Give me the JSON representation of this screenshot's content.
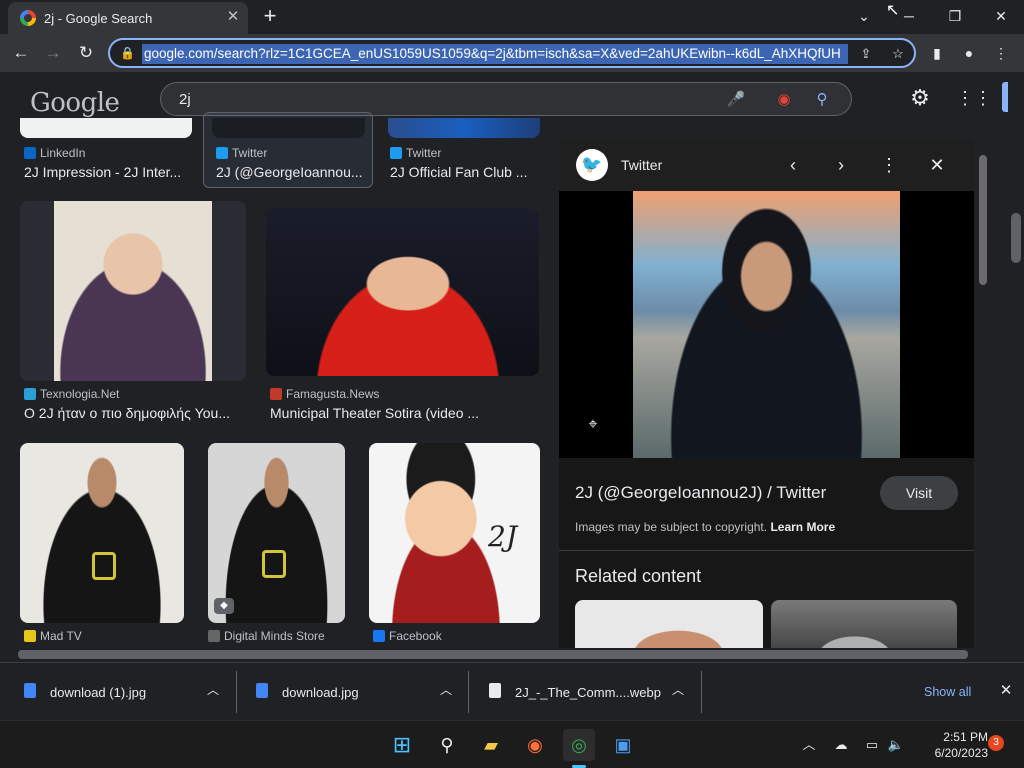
{
  "browser": {
    "tab_title": "2j - Google Search",
    "tab_close": "✕",
    "new_tab": "+",
    "url": "google.com/search?rlz=1C1GCEA_enUS1059US1059&q=2j&tbm=isch&sa=X&ved=2ahUKEwibn--k6dL_AhXHQfUH"
  },
  "google": {
    "logo": "Google",
    "query": "2j"
  },
  "results": {
    "row0": [
      {
        "source": "LinkedIn",
        "caption": "2J Impression - 2J Inter..."
      },
      {
        "source": "Twitter",
        "caption": "2J (@GeorgeIoannou..."
      },
      {
        "source": "Twitter",
        "caption": "2J Official Fan Club ..."
      }
    ],
    "row1": [
      {
        "source": "Texnologia.Net",
        "caption": "Ο 2J ήταν ο πιο δημοφιλής You..."
      },
      {
        "source": "Famagusta.News",
        "caption": "Municipal Theater Sotira (video ..."
      }
    ],
    "row2": [
      {
        "source": "Mad TV"
      },
      {
        "source": "Digital Minds Store"
      },
      {
        "source": "Facebook"
      }
    ],
    "art_text": "2J"
  },
  "panel": {
    "source": "Twitter",
    "title": "2J (@GeorgeIoannou2J) / Twitter",
    "visit": "Visit",
    "copyright": "Images may be subject to copyright.",
    "learn_more": "Learn More",
    "related": "Related content"
  },
  "downloads": {
    "items": [
      {
        "name": "download (1).jpg"
      },
      {
        "name": "download.jpg"
      },
      {
        "name": "2J_-_The_Comm....webp"
      }
    ],
    "show_all": "Show all"
  },
  "taskbar": {
    "time": "2:51 PM",
    "date": "6/20/2023",
    "notifications": "3"
  },
  "colors": {
    "accent": "#8ab4f8",
    "twitter": "#1d9bf0"
  }
}
